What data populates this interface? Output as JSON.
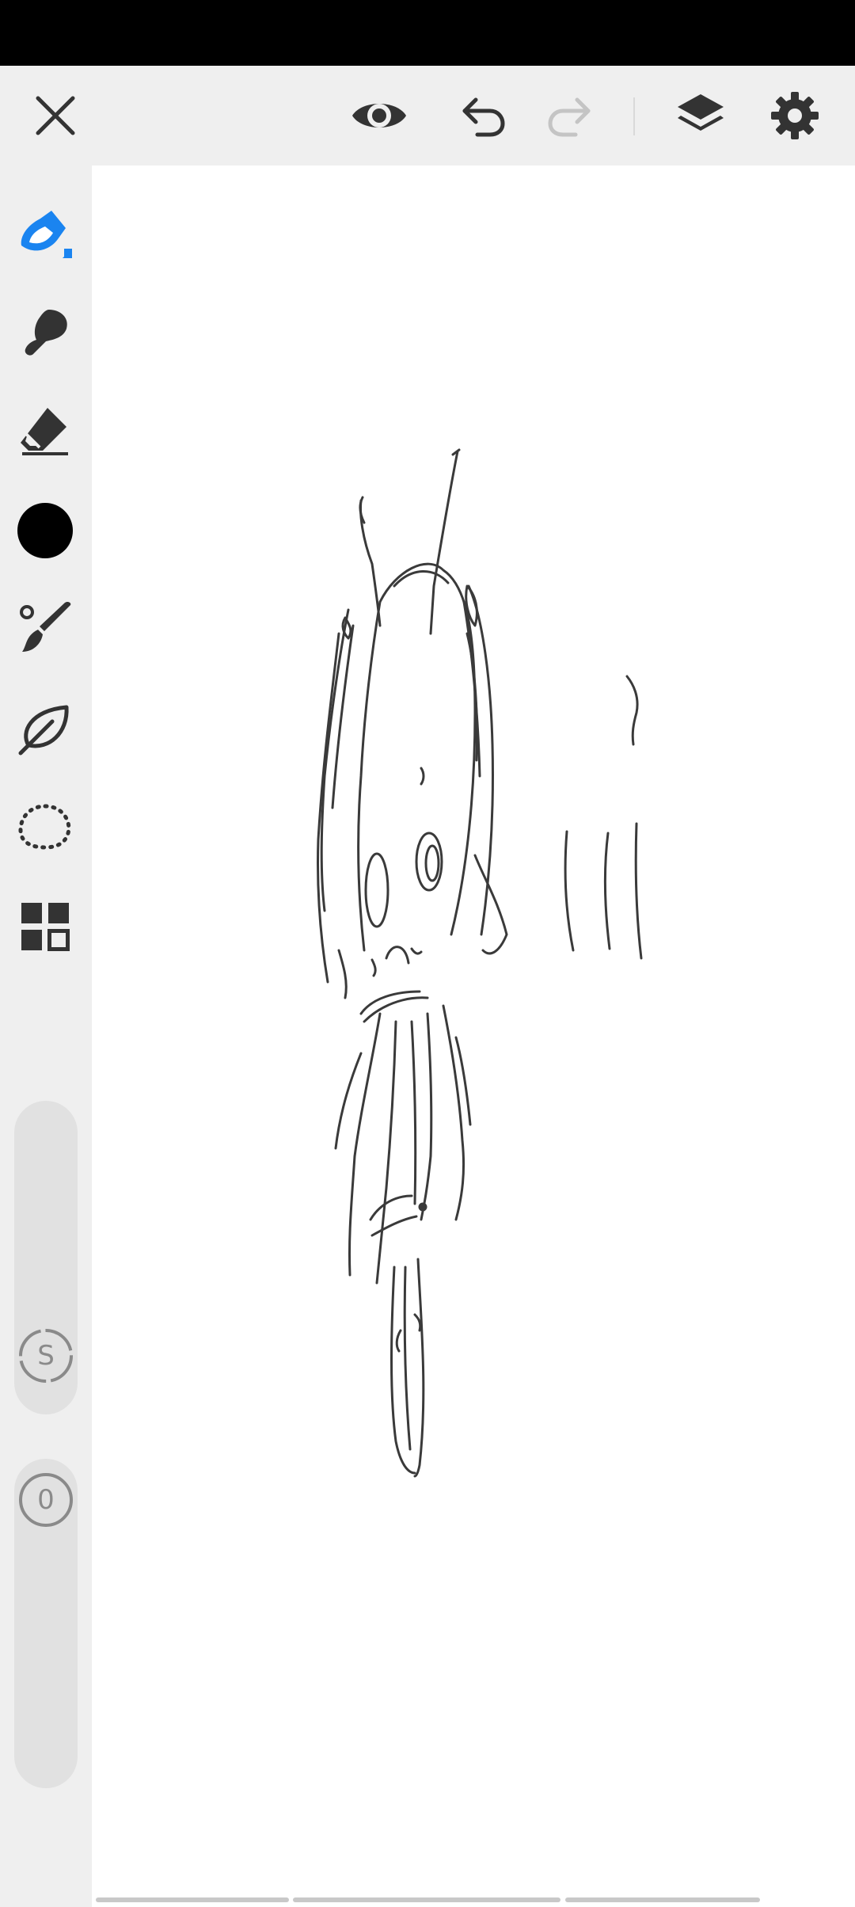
{
  "app": {
    "accent_color": "#1a84f0",
    "icon_color": "#333333",
    "disabled_icon_color": "#c4c4c4"
  },
  "toolbar": {
    "close_icon": "close-icon",
    "preview_icon": "eye-icon",
    "undo_icon": "undo-icon",
    "redo_icon": "redo-icon",
    "redo_enabled": false,
    "layers_icon": "layers-icon",
    "settings_icon": "gear-icon"
  },
  "sidebar": {
    "tools": [
      {
        "name": "pen",
        "icon": "pen-icon",
        "selected": true
      },
      {
        "name": "smudge",
        "icon": "smudge-icon"
      },
      {
        "name": "eraser",
        "icon": "eraser-icon"
      },
      {
        "name": "color",
        "icon": "color-swatch",
        "color": "#000000"
      },
      {
        "name": "brush-settings",
        "icon": "brush-icon"
      },
      {
        "name": "stabilizer",
        "icon": "leaf-icon"
      },
      {
        "name": "lasso",
        "icon": "lasso-icon"
      },
      {
        "name": "more-tools",
        "icon": "grid-icon"
      }
    ],
    "size_slider": {
      "label": "S"
    },
    "opacity_slider": {
      "label": "0"
    }
  },
  "canvas": {
    "content": "pencil-sketch"
  }
}
